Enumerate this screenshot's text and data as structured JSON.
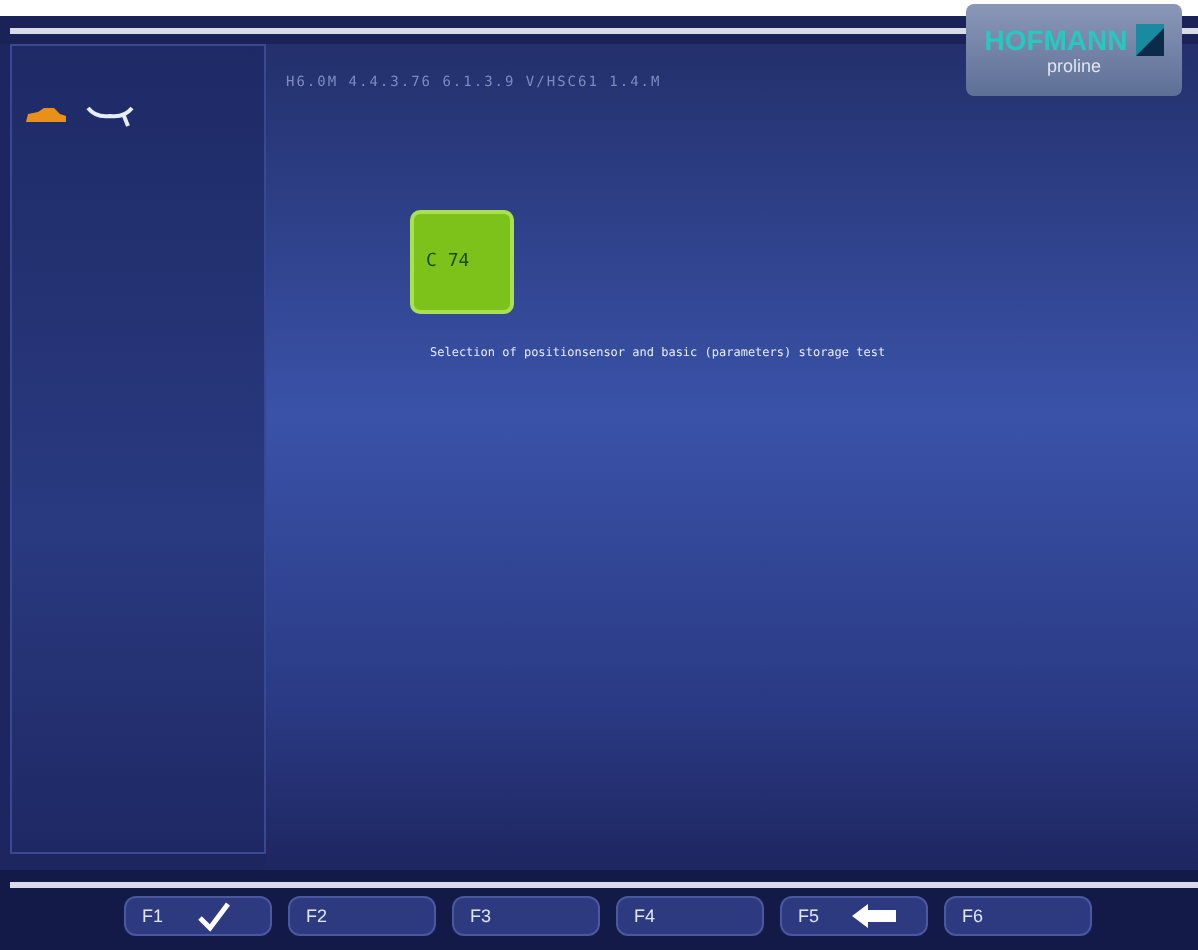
{
  "header": {
    "info": "H6.0M  4.4.3.76 6.1.3.9  V/HSC61 1.4.M"
  },
  "logo": {
    "name": "HOFMANN",
    "sub": "proline"
  },
  "code_badge": {
    "label": "C 74"
  },
  "message": "Selection of positionsensor and basic (parameters) storage test",
  "function_keys": [
    {
      "label": "F1",
      "kind": "confirm"
    },
    {
      "label": "F2",
      "kind": "plain"
    },
    {
      "label": "F3",
      "kind": "plain"
    },
    {
      "label": "F4",
      "kind": "plain"
    },
    {
      "label": "F5",
      "kind": "back"
    },
    {
      "label": "F6",
      "kind": "plain"
    }
  ]
}
